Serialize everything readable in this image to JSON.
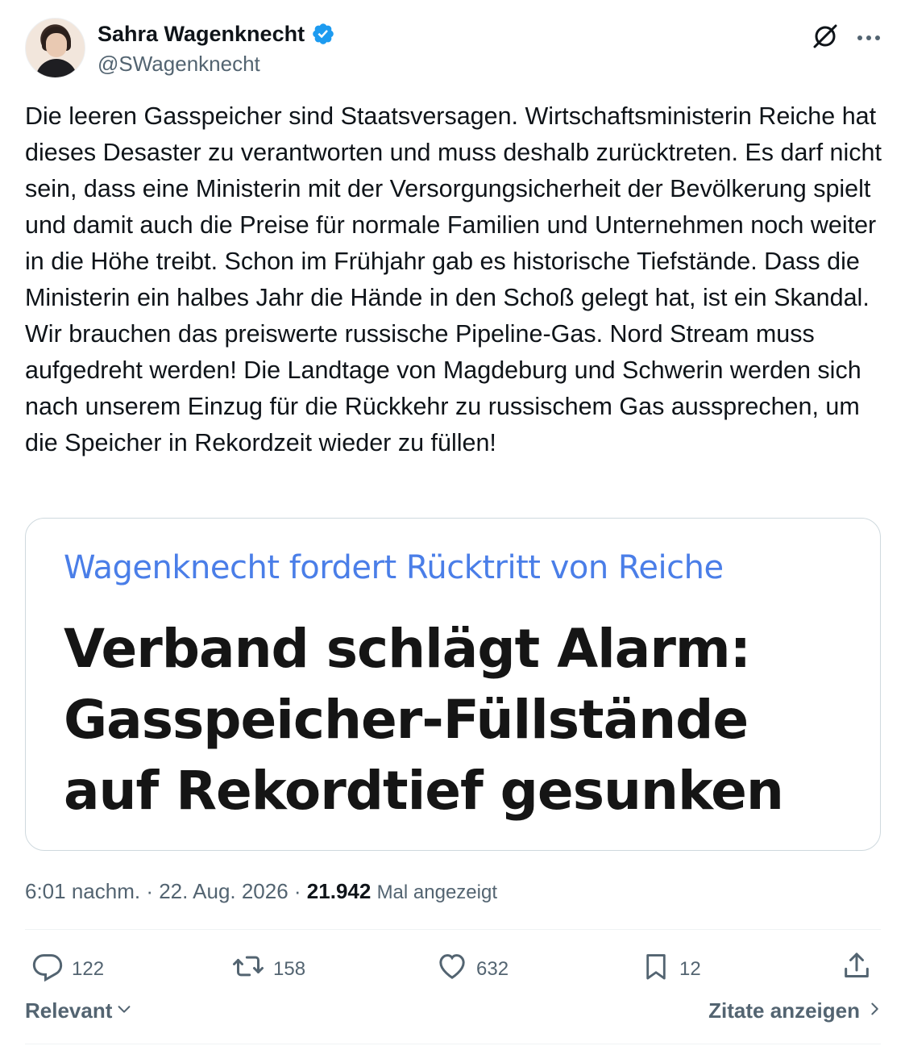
{
  "author": {
    "display_name": "Sahra Wagenknecht",
    "handle": "@SWagenknecht"
  },
  "icons": {
    "verified": "verified-badge-icon",
    "grok": "grok-icon",
    "more": "more-icon"
  },
  "tweet": {
    "text": "Die leeren Gasspeicher sind Staatsversagen. Wirtschaftsministerin Reiche hat dieses Desaster zu verantworten und muss deshalb zurücktreten. Es darf nicht sein, dass eine Ministerin mit der Versorgungsicherheit der Bevölkerung spielt und damit auch die Preise für normale Familien und Unternehmen noch weiter in die Höhe treibt. Schon im Frühjahr gab es historische Tiefstände. Dass die Ministerin ein halbes Jahr die Hände in den Schoß gelegt hat, ist ein Skandal. Wir brauchen das preiswerte russische Pipeline-Gas. Nord Stream muss aufgedreht werden! Die Landtage von Magdeburg und Schwerin werden sich nach unserem Einzug für die Rückkehr zu russischem Gas aussprechen, um die Speicher in Rekordzeit wieder zu füllen!"
  },
  "card": {
    "kicker": "Wagenknecht fordert Rücktritt von Reiche",
    "headline": "Verband schlägt Alarm: Gasspeicher-Füllstände auf Rekordtief gesunken"
  },
  "meta": {
    "time": "6:01 nachm.",
    "sep1": " · ",
    "date": "22. Aug. 2026",
    "sep2": " · ",
    "views": "21.942",
    "views_label": "Mal angezeigt"
  },
  "actions": {
    "replies": "122",
    "reposts": "158",
    "likes": "632",
    "bookmarks": "12"
  },
  "footer": {
    "sort_label": "Relevant",
    "quotes_label": "Zitate anzeigen"
  },
  "colors": {
    "text": "#0f1419",
    "secondary": "#536471",
    "verified": "#1d9bf0",
    "kicker": "#4a7ee8",
    "border": "#cfd9de"
  }
}
